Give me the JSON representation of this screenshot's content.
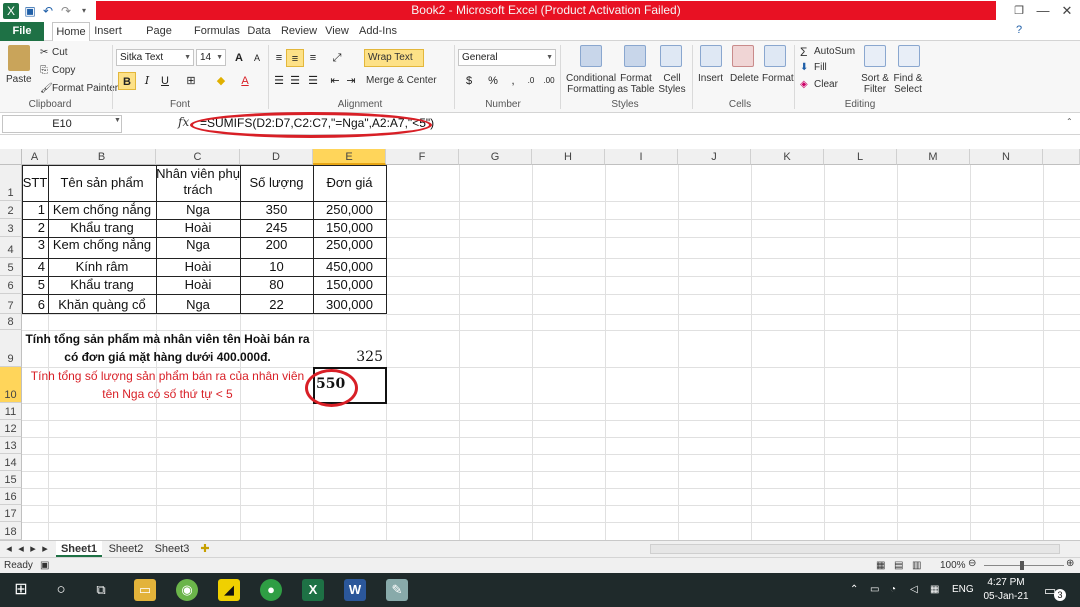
{
  "window": {
    "title": "Book2 - Microsoft Excel (Product Activation Failed)"
  },
  "tabs": [
    "File",
    "Home",
    "Insert",
    "Page Layout",
    "Formulas",
    "Data",
    "Review",
    "View",
    "Add-Ins"
  ],
  "ribbon": {
    "clipboard": {
      "paste": "Paste",
      "cut": "Cut",
      "copy": "Copy",
      "format_painter": "Format Painter",
      "label": "Clipboard"
    },
    "font": {
      "name": "Sitka Text",
      "size": "14",
      "label": "Font"
    },
    "alignment": {
      "wrap_text": "Wrap Text",
      "merge": "Merge & Center",
      "label": "Alignment"
    },
    "number": {
      "format": "General",
      "label": "Number"
    },
    "styles": {
      "conditional": "Conditional Formatting",
      "format_table": "Format as Table",
      "cell_styles": "Cell Styles",
      "label": "Styles"
    },
    "cells": {
      "insert": "Insert",
      "delete": "Delete",
      "format": "Format",
      "label": "Cells"
    },
    "editing": {
      "autosum": "AutoSum",
      "fill": "Fill",
      "clear": "Clear",
      "sort": "Sort & Filter",
      "find": "Find & Select",
      "label": "Editing"
    }
  },
  "formula_bar": {
    "name_box": "E10",
    "fx": "fx",
    "formula": "=SUMIFS(D2:D7,C2:C7,\"=Nga\",A2:A7,\"<5\")"
  },
  "columns": [
    "A",
    "B",
    "C",
    "D",
    "E",
    "F",
    "G",
    "H",
    "I",
    "J",
    "K",
    "L",
    "M",
    "N"
  ],
  "rows": [
    "1",
    "2",
    "3",
    "4",
    "5",
    "6",
    "7",
    "8",
    "9",
    "10",
    "11",
    "12",
    "13",
    "14",
    "15",
    "16",
    "17",
    "18"
  ],
  "table": {
    "headers": [
      "STT",
      "Tên sản phẩm",
      "Nhân viên phụ trách",
      "Số lượng",
      "Đơn giá"
    ],
    "rows": [
      [
        "1",
        "Kem chống nắng",
        "Nga",
        "350",
        "250,000"
      ],
      [
        "2",
        "Khẩu trang",
        "Hoài",
        "245",
        "150,000"
      ],
      [
        "3",
        "Kem chống nắng",
        "Nga",
        "200",
        "250,000"
      ],
      [
        "4",
        "Kính râm",
        "Hoài",
        "10",
        "450,000"
      ],
      [
        "5",
        "Khẩu trang",
        "Hoài",
        "80",
        "150,000"
      ],
      [
        "6",
        "Khăn quàng cổ",
        "Nga",
        "22",
        "300,000"
      ]
    ]
  },
  "question1": {
    "line1": "Tính tổng sản phẩm mà nhân viên tên Hoài bán ra",
    "line2": "có đơn giá mặt hàng dưới 400.000đ.",
    "answer": "325"
  },
  "question2": {
    "line1": "Tính tổng số lượng sản phẩm bán ra của nhân viên",
    "line2": "tên Nga có số thứ tự < 5",
    "answer": "550"
  },
  "sheets": [
    "Sheet1",
    "Sheet2",
    "Sheet3"
  ],
  "status": {
    "ready": "Ready",
    "zoom": "100%"
  },
  "taskbar": {
    "lang": "ENG",
    "time": "4:27 PM",
    "date": "05-Jan-21",
    "notif": "3"
  },
  "colors": {
    "title_red": "#e81123",
    "file_green": "#1e7145",
    "highlight_red": "#d81f26",
    "question_red": "#d81f26"
  }
}
